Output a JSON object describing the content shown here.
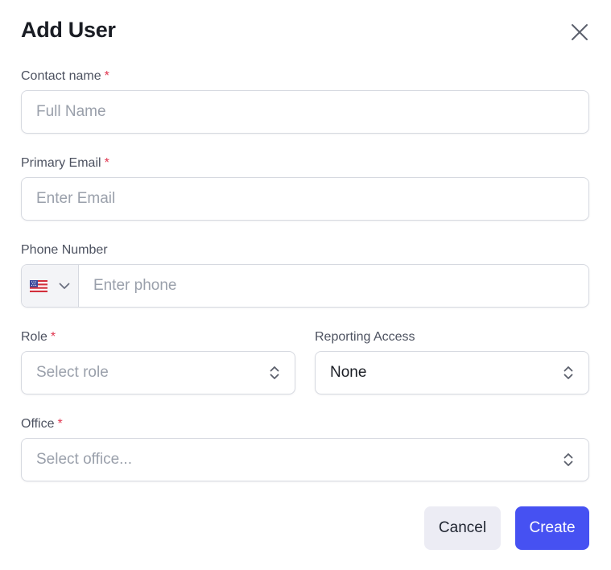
{
  "dialog": {
    "title": "Add User",
    "close_icon": "close-icon"
  },
  "fields": {
    "contact_name": {
      "label": "Contact name",
      "required_mark": "*",
      "placeholder": "Full Name",
      "value": ""
    },
    "primary_email": {
      "label": "Primary Email",
      "required_mark": "*",
      "placeholder": "Enter Email",
      "value": ""
    },
    "phone_number": {
      "label": "Phone Number",
      "country_icon": "us-flag-icon",
      "placeholder": "Enter phone",
      "value": ""
    },
    "role": {
      "label": "Role",
      "required_mark": "*",
      "selected": "Select role"
    },
    "reporting_access": {
      "label": "Reporting Access",
      "selected": "None"
    },
    "office": {
      "label": "Office",
      "required_mark": "*",
      "selected": "Select office..."
    }
  },
  "actions": {
    "cancel_label": "Cancel",
    "create_label": "Create"
  },
  "colors": {
    "primary": "#4651f2",
    "required": "#e0354f",
    "cancel_bg": "#ececf4"
  }
}
